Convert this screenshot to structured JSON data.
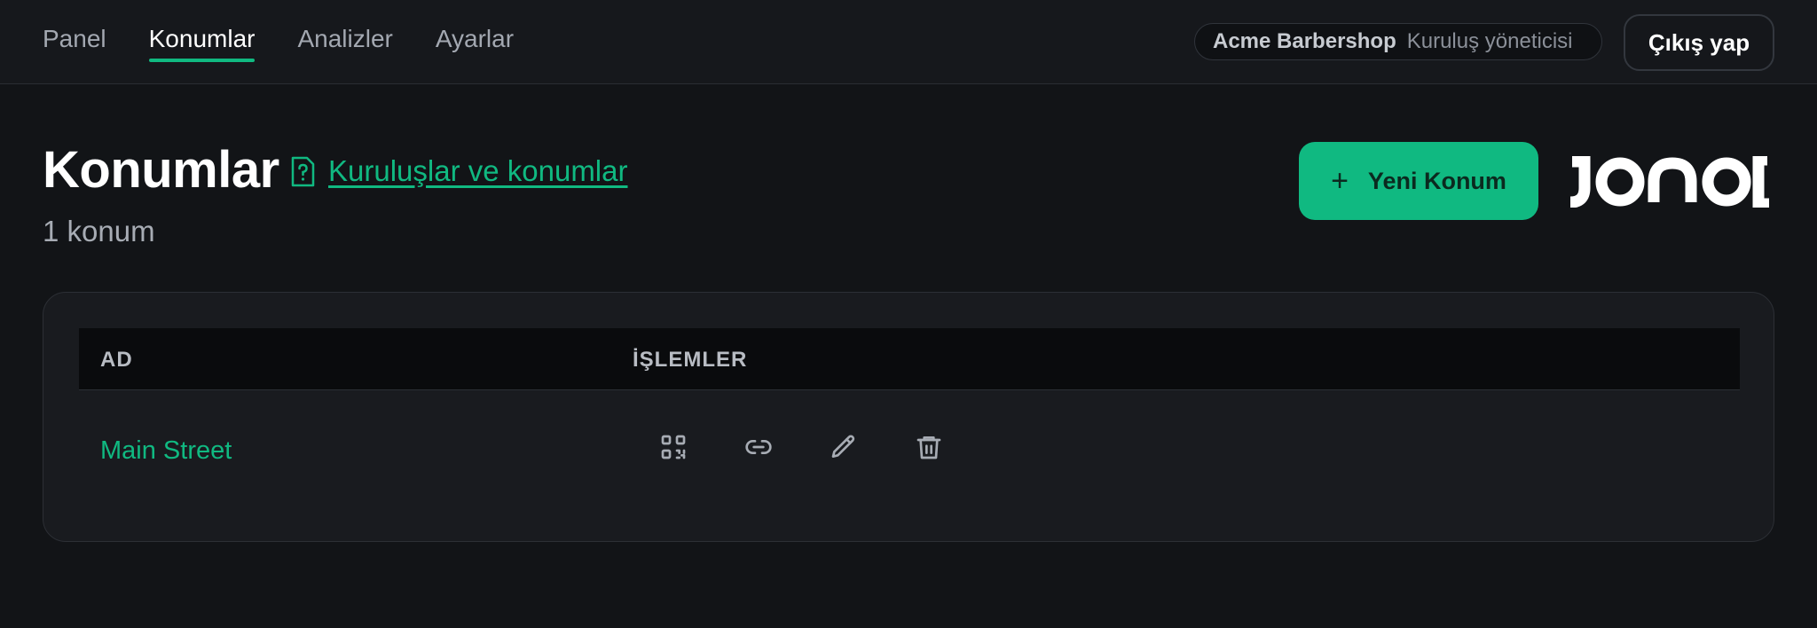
{
  "nav": {
    "items": [
      {
        "label": "Panel",
        "active": false
      },
      {
        "label": "Konumlar",
        "active": true
      },
      {
        "label": "Analizler",
        "active": false
      },
      {
        "label": "Ayarlar",
        "active": false
      }
    ]
  },
  "org": {
    "name": "Acme Barbershop",
    "role": "Kuruluş yöneticisi"
  },
  "logout_label": "Çıkış yap",
  "header": {
    "title": "Konumlar",
    "help_link": "Kuruluşlar ve konumlar",
    "count": "1 konum",
    "new_button": "Yeni Konum",
    "new_button_icon": "plus-icon"
  },
  "table": {
    "columns": [
      "AD",
      "İŞLEMLER"
    ],
    "rows": [
      {
        "name": "Main Street",
        "actions": [
          "qr-code-icon",
          "link-icon",
          "edit-icon",
          "delete-icon"
        ]
      }
    ]
  },
  "colors": {
    "accent": "#10b981",
    "background": "#121417"
  }
}
